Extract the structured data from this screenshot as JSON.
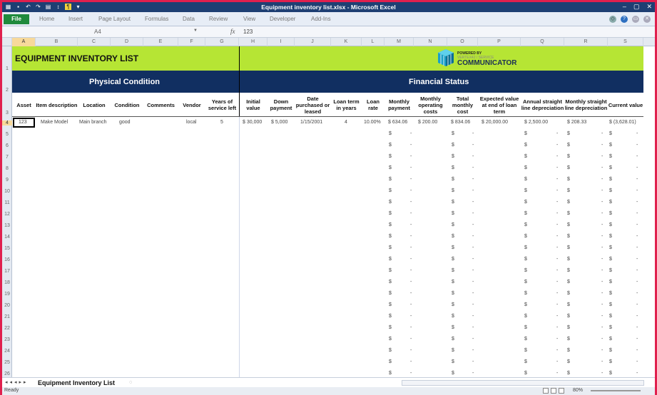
{
  "window": {
    "title": "Equipment inventory list.xlsx  -  Microsoft Excel",
    "controls": [
      "–",
      "▢",
      "✕"
    ]
  },
  "ribbon": {
    "file": "File",
    "tabs": [
      "Home",
      "Insert",
      "Page Layout",
      "Formulas",
      "Data",
      "Review",
      "View",
      "Developer",
      "Add-Ins"
    ]
  },
  "formula_bar": {
    "name_box": "A4",
    "fx": "fx",
    "value": "123"
  },
  "columns": [
    "A",
    "B",
    "C",
    "D",
    "E",
    "F",
    "G",
    "H",
    "I",
    "J",
    "K",
    "L",
    "M",
    "N",
    "O",
    "P",
    "Q",
    "R",
    "S"
  ],
  "rows": [
    "1",
    "2",
    "3",
    "4",
    "5",
    "6",
    "7",
    "8",
    "9",
    "10",
    "11",
    "12",
    "13",
    "14",
    "15",
    "16",
    "17",
    "18",
    "19",
    "20",
    "21",
    "22",
    "23",
    "24",
    "25",
    "26"
  ],
  "sheet": {
    "title": "EQUIPMENT INVENTORY LIST",
    "logo": {
      "small": "POWERED BY",
      "sub": "VERTEX42 / SERVICE",
      "big": "COMMUNICATOR"
    },
    "section_physical": "Physical Condition",
    "section_financial": "Financial Status",
    "headers": [
      "Asset",
      "Item description",
      "Location",
      "Condition",
      "Comments",
      "Vendor",
      "Years of service left",
      "Initial value",
      "Down payment",
      "Date purchased or leased",
      "Loan term in years",
      "Loan rate",
      "Monthly payment",
      "Monthly operating costs",
      "Total monthly cost",
      "Expected value at end of loan term",
      "Annual straight line depreciation",
      "Monthly straight line depreciation",
      "Current value"
    ],
    "row4": [
      "123",
      "Make Model",
      "Main branch",
      "good",
      "",
      "local",
      "5",
      "$ 30,000",
      "$  5,000",
      "1/15/2001",
      "4",
      "10.00%",
      "$  634.06",
      "$   200.00",
      "$  834.06",
      "$    20,000.00",
      "$           2,500.00",
      "$          208.33",
      "$  (3,628.01)"
    ],
    "empty_marker": "$",
    "dash": "-"
  },
  "sheet_tab": "Equipment Inventory List",
  "status": {
    "ready": "Ready",
    "zoom": "80%"
  }
}
